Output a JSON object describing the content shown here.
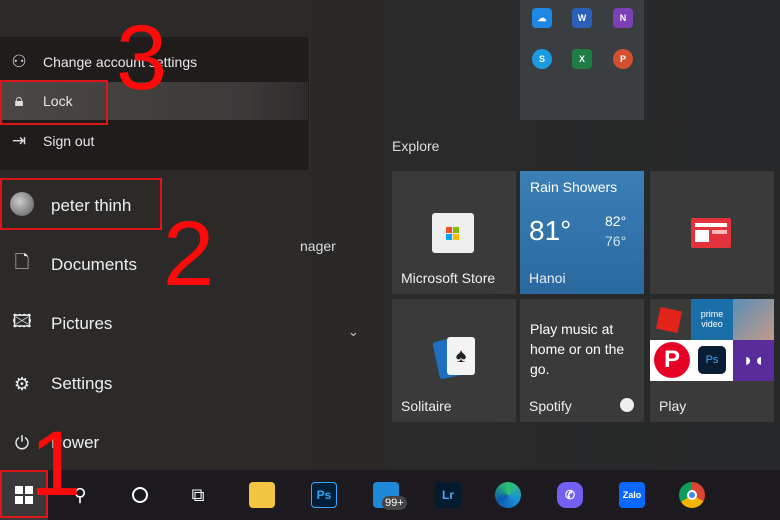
{
  "account_menu": {
    "items": [
      {
        "label": "Change account settings",
        "icon": "account-settings-icon"
      },
      {
        "label": "Lock",
        "icon": "lock-icon"
      },
      {
        "label": "Sign out",
        "icon": "sign-out-icon"
      }
    ]
  },
  "user": {
    "name": "peter thinh"
  },
  "sidebar": {
    "items": [
      {
        "label": "Documents",
        "icon": "document-icon"
      },
      {
        "label": "Pictures",
        "icon": "pictures-icon"
      },
      {
        "label": "Settings",
        "icon": "gear-icon"
      },
      {
        "label": "Power",
        "icon": "power-icon"
      }
    ]
  },
  "app_list": {
    "partial_item": "nager"
  },
  "tiles": {
    "office_group": [
      "OneDrive",
      "Word",
      "OneNote",
      "Skype",
      "Excel",
      "PowerPoint"
    ],
    "group_title": "Explore",
    "store": {
      "label": "Microsoft Store"
    },
    "weather": {
      "condition": "Rain Showers",
      "temp": "81°",
      "high": "82°",
      "low": "76°",
      "city": "Hanoi",
      "color": "#2d6ea3"
    },
    "news": {
      "icon": "news-icon"
    },
    "solitaire": {
      "label": "Solitaire"
    },
    "spotify": {
      "text": "Play music at home or on the go.",
      "label": "Spotify"
    },
    "play": {
      "label": "Play",
      "mini": [
        "Roblox",
        "prime video",
        "Game",
        "Pinterest",
        "Ps",
        "Dolby"
      ]
    }
  },
  "taskbar": {
    "badge": "99+",
    "apps": [
      "File Explorer",
      "Photoshop",
      "Mail",
      "Lightroom",
      "Edge",
      "Viber",
      "Zalo",
      "Chrome"
    ],
    "ps": "Ps",
    "lr": "Lr",
    "zalo": "Zalo"
  },
  "annotations": {
    "step1": "1",
    "step2": "2",
    "step3": "3",
    "color": "#ff0a0a"
  }
}
